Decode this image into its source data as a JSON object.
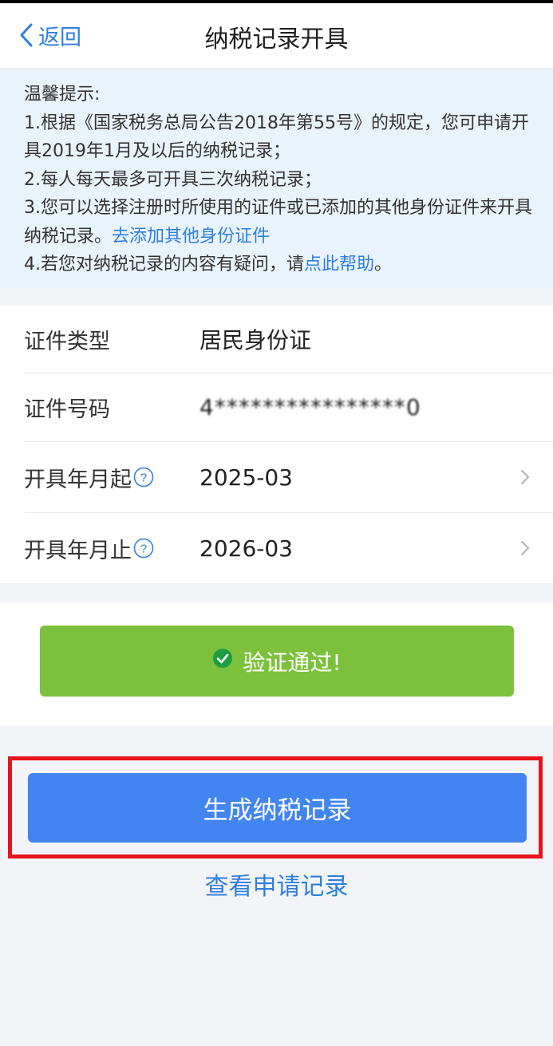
{
  "navbar": {
    "back_label": "返回",
    "title": "纳税记录开具"
  },
  "tips": {
    "heading": "温馨提示:",
    "line1": "1.根据《国家税务总局公告2018年第55号》的规定，您可申请开具2019年1月及以后的纳税记录；",
    "line2": "2.每人每天最多可开具三次纳税记录；",
    "line3_text": "3.您可以选择注册时所使用的证件或已添加的其他身份证件来开具纳税记录。",
    "line3_link": "去添加其他身份证件",
    "line4_text": "4.若您对纳税记录的内容有疑问，请",
    "line4_link": "点此帮助",
    "line4_end": "。"
  },
  "form": {
    "id_type_label": "证件类型",
    "id_type_value": "居民身份证",
    "id_number_label": "证件号码",
    "id_number_value": "4****************0",
    "start_label": "开具年月起",
    "start_value": "2025-03",
    "end_label": "开具年月止",
    "end_value": "2026-03"
  },
  "verify": {
    "label": "验证通过!"
  },
  "actions": {
    "generate_label": "生成纳税记录",
    "records_link": "查看申请记录"
  },
  "colors": {
    "accent": "#2f7fe0",
    "primary_button": "#4285f0",
    "success_button": "#7cc13c",
    "highlight_border": "#e8141b",
    "tips_background": "#e9f3fc"
  },
  "icons": {
    "back": "chevron-left-icon",
    "help": "question-circle-icon",
    "row_arrow": "chevron-right-icon",
    "verified": "check-circle-icon"
  }
}
